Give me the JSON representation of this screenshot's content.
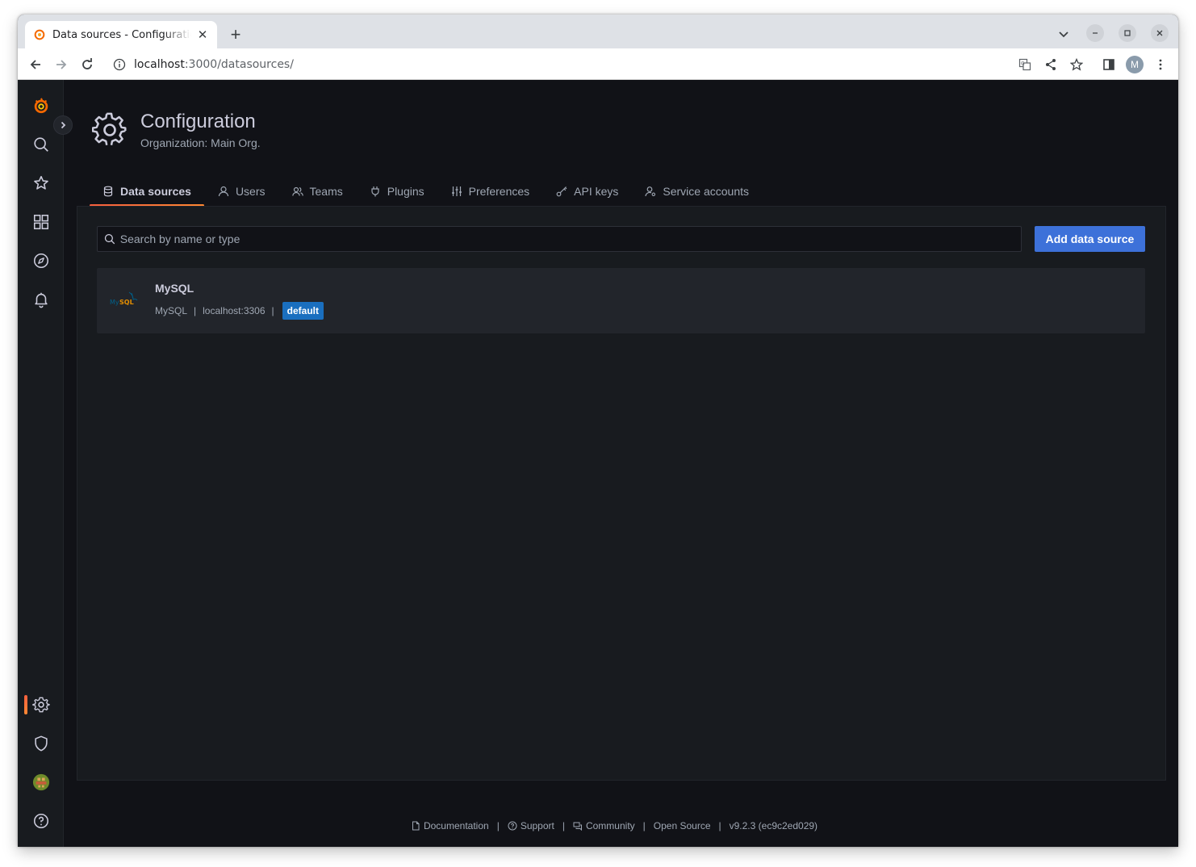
{
  "browser": {
    "tab_title": "Data sources - Configuration",
    "url_host": "localhost",
    "url_rest": ":3000/datasources/",
    "profile_initial": "M"
  },
  "sidenav": {
    "items": [
      "grafana-logo",
      "search",
      "starred",
      "dashboards",
      "explore",
      "alerting",
      "configuration",
      "server-admin",
      "profile",
      "help"
    ]
  },
  "header": {
    "title": "Configuration",
    "subtitle": "Organization: Main Org."
  },
  "tabs": [
    {
      "label": "Data sources",
      "icon": "database-icon",
      "active": true
    },
    {
      "label": "Users",
      "icon": "user-icon",
      "active": false
    },
    {
      "label": "Teams",
      "icon": "users-icon",
      "active": false
    },
    {
      "label": "Plugins",
      "icon": "plug-icon",
      "active": false
    },
    {
      "label": "Preferences",
      "icon": "sliders-icon",
      "active": false
    },
    {
      "label": "API keys",
      "icon": "key-icon",
      "active": false
    },
    {
      "label": "Service accounts",
      "icon": "user-cog-icon",
      "active": false
    }
  ],
  "search": {
    "placeholder": "Search by name or type"
  },
  "add_button_label": "Add data source",
  "datasources": [
    {
      "name": "MySQL",
      "type": "MySQL",
      "url": "localhost:3306",
      "badge": "default"
    }
  ],
  "footer": {
    "documentation": "Documentation",
    "support": "Support",
    "community": "Community",
    "open_source": "Open Source",
    "version": "v9.2.3 (ec9c2ed029)"
  },
  "colors": {
    "accent": "#f55f3e",
    "primary_button": "#3d71d9",
    "background": "#111217",
    "panel": "#181b1f"
  }
}
